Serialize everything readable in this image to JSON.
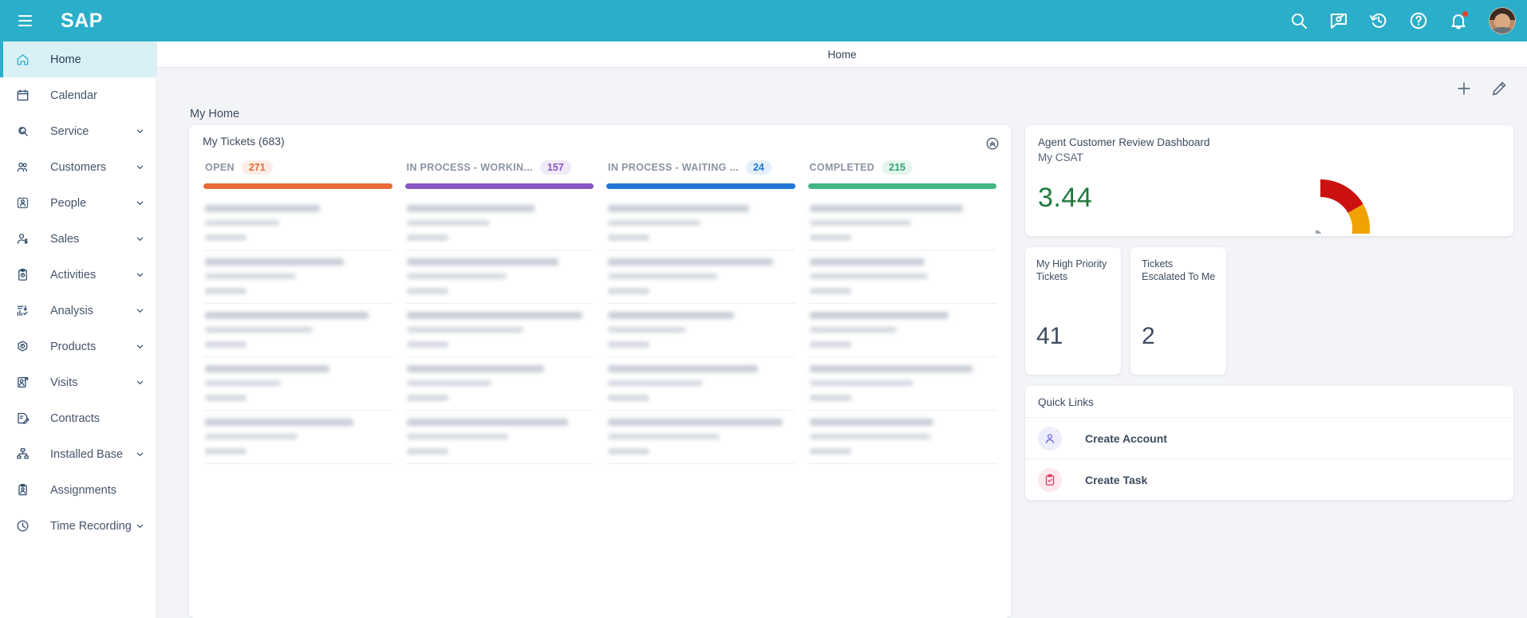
{
  "topbar": {
    "logo_text": "SAP",
    "menu_icon": "hamburger-icon",
    "icons": [
      {
        "name": "search-icon",
        "label": "Search"
      },
      {
        "name": "chat-icon",
        "label": "Chat"
      },
      {
        "name": "history-icon",
        "label": "Recent History"
      },
      {
        "name": "help-icon",
        "label": "Help"
      },
      {
        "name": "notifications-icon",
        "label": "Notifications"
      }
    ],
    "avatar_label": "User Profile",
    "background_color": "#2BAEC9"
  },
  "page_header": {
    "title": "Home"
  },
  "sidebar": {
    "items": [
      {
        "label": "Home",
        "icon": "home-icon",
        "expandable": false,
        "active": true
      },
      {
        "label": "Calendar",
        "icon": "calendar-icon",
        "expandable": false,
        "active": false
      },
      {
        "label": "Service",
        "icon": "service-icon",
        "expandable": true,
        "active": false
      },
      {
        "label": "Customers",
        "icon": "customers-icon",
        "expandable": true,
        "active": false
      },
      {
        "label": "People",
        "icon": "people-icon",
        "expandable": true,
        "active": false
      },
      {
        "label": "Sales",
        "icon": "sales-icon",
        "expandable": true,
        "active": false
      },
      {
        "label": "Activities",
        "icon": "activities-icon",
        "expandable": true,
        "active": false
      },
      {
        "label": "Analysis",
        "icon": "analysis-icon",
        "expandable": true,
        "active": false
      },
      {
        "label": "Products",
        "icon": "products-icon",
        "expandable": true,
        "active": false
      },
      {
        "label": "Visits",
        "icon": "visits-icon",
        "expandable": true,
        "active": false
      },
      {
        "label": "Contracts",
        "icon": "contracts-icon",
        "expandable": false,
        "active": false
      },
      {
        "label": "Installed Base",
        "icon": "installed-base-icon",
        "expandable": true,
        "active": false
      },
      {
        "label": "Assignments",
        "icon": "assignments-icon",
        "expandable": false,
        "active": false
      },
      {
        "label": "Time Recording",
        "icon": "time-recording-icon",
        "expandable": true,
        "active": false
      }
    ]
  },
  "content_toolbar": {
    "add_label": "Add",
    "add_icon": "plus-icon",
    "edit_label": "Edit",
    "edit_icon": "pencil-icon"
  },
  "main": {
    "section_title": "My Home",
    "tickets": {
      "title": "My Tickets (683)",
      "collapse_icon": "chevron-up-circle-icon",
      "columns": [
        {
          "label": "OPEN",
          "count": "271",
          "bar_color": "#EA6A33",
          "count_color": "#EA6A33",
          "count_bg": "#FCEDE6"
        },
        {
          "label": "IN PROCESS - WORKIN...",
          "count": "157",
          "bar_color": "#8957C4",
          "count_color": "#8957C4",
          "count_bg": "#F0EAF8"
        },
        {
          "label": "IN PROCESS - WAITING ...",
          "count": "24",
          "bar_color": "#2377D4",
          "count_color": "#2377D4",
          "count_bg": "#E4EFFB"
        },
        {
          "label": "COMPLETED",
          "count": "215",
          "bar_color": "#43B584",
          "count_color": "#34A372",
          "count_bg": "#E5F5EE"
        }
      ],
      "card_rows": 5
    }
  },
  "rail": {
    "csat": {
      "title": "Agent Customer Review Dashboard",
      "subtitle": "My CSAT",
      "value": "3.44",
      "value_color": "#1e7a3c",
      "gauge": {
        "needle_angle_deg": 48,
        "segments": [
          {
            "name": "low",
            "color": "#CC1111",
            "from_deg": -90,
            "to_deg": -30
          },
          {
            "name": "medium",
            "color": "#F0A202",
            "from_deg": -30,
            "to_deg": 12
          },
          {
            "name": "high",
            "color": "#1E7A2E",
            "from_deg": 12,
            "to_deg": 90
          }
        ]
      }
    },
    "kpis": [
      {
        "title": "My High Priority Tickets",
        "value": "41"
      },
      {
        "title": "Tickets Escalated To Me",
        "value": "2"
      }
    ],
    "quick_links": {
      "title": "Quick Links",
      "items": [
        {
          "label": "Create Account",
          "icon": "person-icon",
          "icon_color": "#5B5BD6",
          "icon_bg": "#EDEDFB"
        },
        {
          "label": "Create Task",
          "icon": "clipboard-check-icon",
          "icon_color": "#D63B5B",
          "icon_bg": "#FBE9EE"
        }
      ]
    }
  }
}
